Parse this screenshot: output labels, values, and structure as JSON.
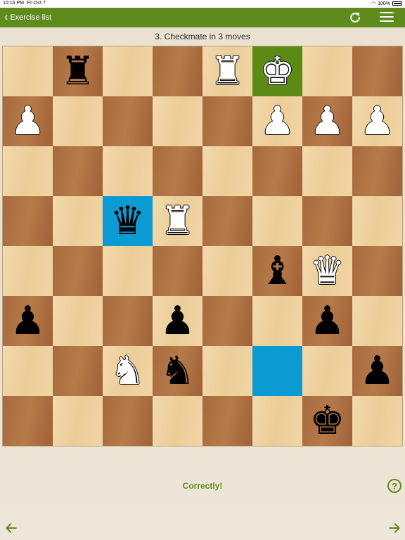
{
  "status_bar": {
    "time": "10:16 PM",
    "date": "Fri Oct 7",
    "battery": "100%"
  },
  "nav": {
    "back_label": "Exercise list"
  },
  "title": "3. Checkmate in 3 moves",
  "message": "Correctly!",
  "help_label": "?",
  "colors": {
    "accent": "#5e8b1c",
    "highlight_green": "#5b8b14",
    "highlight_blue": "#0a9bd3"
  },
  "board": {
    "highlights": {
      "0,5": "green",
      "3,2": "blue",
      "6,5": "blue"
    },
    "rows": [
      [
        "",
        "bR",
        "",
        "",
        "wR",
        "wK",
        "",
        ""
      ],
      [
        "wP",
        "",
        "",
        "",
        "",
        "wP",
        "wP",
        "wP"
      ],
      [
        "",
        "",
        "",
        "",
        "",
        "",
        "",
        ""
      ],
      [
        "",
        "",
        "bQ",
        "wR",
        "",
        "",
        "",
        ""
      ],
      [
        "",
        "",
        "",
        "",
        "",
        "bB",
        "wQ",
        ""
      ],
      [
        "bP",
        "",
        "",
        "bP",
        "",
        "",
        "bP",
        ""
      ],
      [
        "",
        "",
        "wN",
        "bN",
        "",
        "",
        "",
        "bP"
      ],
      [
        "",
        "",
        "",
        "",
        "",
        "",
        "bK",
        ""
      ]
    ]
  }
}
